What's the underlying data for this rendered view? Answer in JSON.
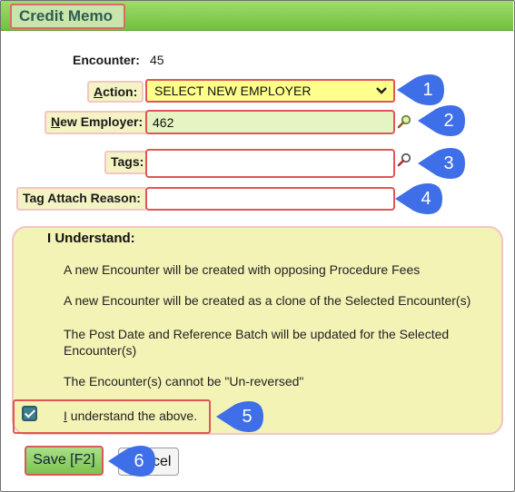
{
  "window": {
    "title": "Credit Memo"
  },
  "form": {
    "encounter_label": "Encounter:",
    "encounter_value": "45",
    "action_label_u": "A",
    "action_label_rest": "ction:",
    "action_value": "SELECT NEW EMPLOYER",
    "employer_label_u": "N",
    "employer_label_rest": "ew Employer:",
    "employer_value": "462",
    "tags_label": "Tags:",
    "tags_value": "",
    "tag_reason_label": "Tag Attach Reason:",
    "tag_reason_value": ""
  },
  "panel": {
    "title": "I Understand:",
    "lines": [
      "A new Encounter will be created with opposing Procedure Fees",
      "A new Encounter will be created as a clone of the Selected Encounter(s)",
      "The Post Date and Reference Batch will be updated for the Selected",
      "Encounter(s)",
      "The Encounter(s) cannot be \"Un-reversed\""
    ],
    "checkbox_label_u": "I",
    "checkbox_label_rest": " understand the above.",
    "checkbox_checked": true
  },
  "buttons": {
    "save": "Save [F2]",
    "cancel": "Cancel"
  },
  "callouts": [
    "1",
    "2",
    "3",
    "4",
    "5",
    "6"
  ],
  "colors": {
    "header_green": "#71c040",
    "callout_blue": "#3e6ee8",
    "highlight_red": "#e05656",
    "panel_yellow": "#f3f3b6",
    "action_yellow": "#ffff8c"
  },
  "icons": [
    "magnifier-icon",
    "chevron-down-icon",
    "checkmark-icon"
  ]
}
